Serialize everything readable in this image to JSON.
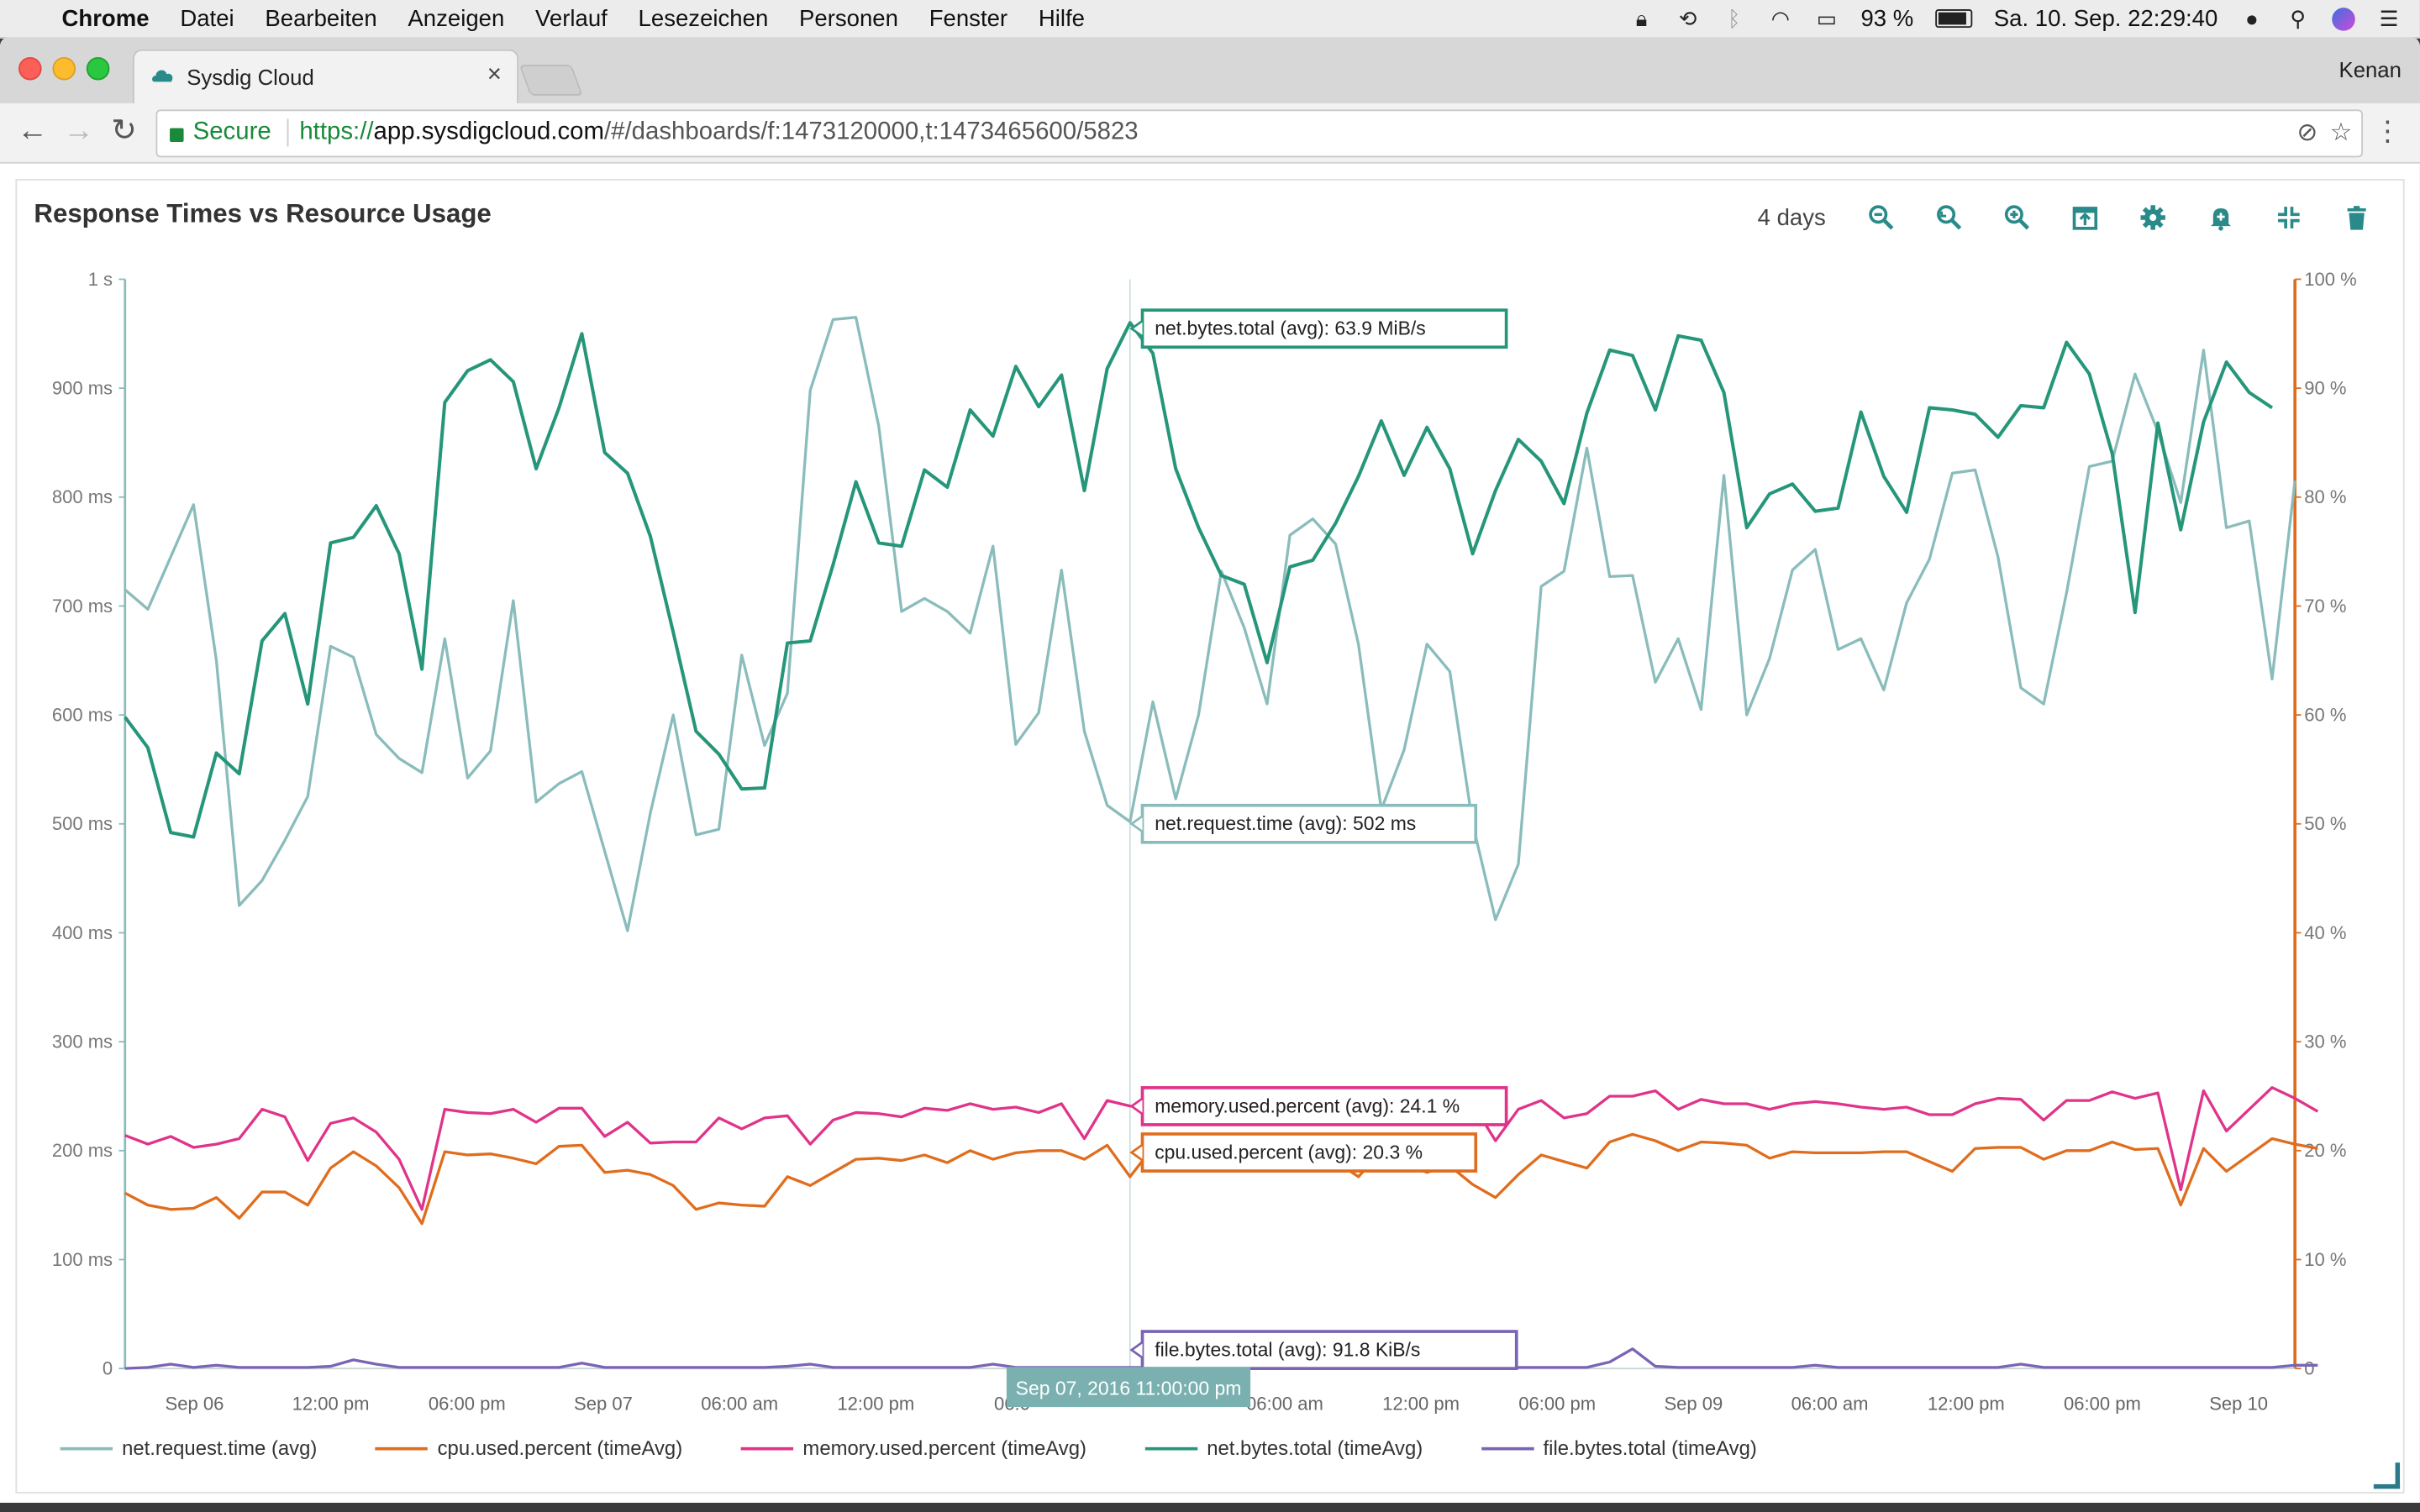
{
  "menubar": {
    "app": "Chrome",
    "items": [
      "Datei",
      "Bearbeiten",
      "Anzeigen",
      "Verlauf",
      "Lesezeichen",
      "Personen",
      "Fenster",
      "Hilfe"
    ],
    "battery": "93 %",
    "datetime": "Sa. 10. Sep.  22:29:40"
  },
  "browser": {
    "tab_title": "Sysdig Cloud",
    "profile": "Kenan",
    "secure_label": "Secure",
    "url_scheme": "https://",
    "url_host": "app.sysdigcloud.com",
    "url_path": "/#/dashboards/f:1473120000,t:1473465600/5823"
  },
  "panel": {
    "title": "Response Times vs Resource Usage",
    "time_range": "4 days",
    "tool_icons": [
      "zoom-out-icon",
      "zoom-reset-icon",
      "zoom-in-icon",
      "open-panel-icon",
      "settings-icon",
      "alert-icon",
      "collapse-icon",
      "delete-icon"
    ],
    "accent": "#2a8a8a"
  },
  "chart_data": {
    "type": "line",
    "x_ticks": [
      "Sep 06",
      "12:00 pm",
      "06:00 pm",
      "Sep 07",
      "06:00 am",
      "12:00 pm",
      "06:0",
      "",
      "06:00 am",
      "12:00 pm",
      "06:00 pm",
      "Sep 09",
      "06:00 am",
      "12:00 pm",
      "06:00 pm",
      "Sep 10"
    ],
    "y_left_ticks": [
      "0",
      "100 ms",
      "200 ms",
      "300 ms",
      "400 ms",
      "500 ms",
      "600 ms",
      "700 ms",
      "800 ms",
      "900 ms",
      "1 s"
    ],
    "y_right_ticks": [
      "0",
      "10 %",
      "20 %",
      "30 %",
      "40 %",
      "50 %",
      "60 %",
      "70 %",
      "80 %",
      "90 %",
      "100 %"
    ],
    "y_left_range": [
      0,
      1000
    ],
    "y_right_range": [
      0,
      100
    ],
    "hover_time": "Sep 07, 2016 11:00:00 pm",
    "series": [
      {
        "name": "net.request.time (avg)",
        "color": "#8bbcbc",
        "axis": "left",
        "tooltip": "net.request.time (avg): 502 ms",
        "values": [
          715,
          697,
          745,
          793,
          650,
          425,
          448,
          485,
          525,
          663,
          653,
          582,
          560,
          547,
          670,
          542,
          567,
          705,
          520,
          537,
          548,
          475,
          402,
          510,
          600,
          490,
          495,
          655,
          572,
          620,
          898,
          963,
          965,
          865,
          695,
          707,
          695,
          675,
          755,
          573,
          602,
          733,
          585,
          517,
          502,
          612,
          523,
          600,
          732,
          680,
          610,
          765,
          780,
          757,
          665,
          513,
          568,
          665,
          640,
          500,
          412,
          463,
          718,
          732,
          845,
          727,
          728,
          630,
          670,
          605,
          820,
          600,
          652,
          733,
          752,
          660,
          670,
          623,
          703,
          743,
          822,
          825,
          745,
          625,
          610,
          712,
          828,
          833,
          913,
          860,
          795,
          935,
          772,
          778,
          633,
          815
        ]
      },
      {
        "name": "cpu.used.percent (timeAvg)",
        "color": "#e06d1e",
        "axis": "right",
        "tooltip": "cpu.used.percent (avg): 20.3 %",
        "values": [
          16.1,
          15.0,
          14.6,
          14.7,
          15.7,
          13.8,
          16.2,
          16.2,
          15.0,
          18.4,
          19.9,
          18.6,
          16.6,
          13.3,
          19.9,
          19.6,
          19.7,
          19.3,
          18.8,
          20.4,
          20.5,
          18.0,
          18.2,
          17.8,
          16.8,
          14.6,
          15.2,
          15.0,
          14.9,
          17.6,
          16.8,
          18.0,
          19.2,
          19.3,
          19.1,
          19.6,
          18.9,
          20.0,
          19.2,
          19.8,
          20.0,
          20.0,
          19.2,
          20.5,
          17.6,
          20.3,
          20.2,
          19.0,
          18.9,
          19.6,
          19.3,
          19.3,
          18.9,
          19.0,
          17.6,
          19.9,
          18.8,
          18.0,
          18.6,
          16.9,
          15.7,
          17.8,
          19.6,
          19.0,
          18.4,
          20.8,
          21.5,
          20.9,
          20.0,
          20.8,
          20.7,
          20.5,
          19.3,
          19.9,
          19.8,
          19.8,
          19.8,
          19.9,
          19.9,
          19.0,
          18.1,
          20.2,
          20.3,
          20.3,
          19.2,
          20.0,
          20.0,
          20.8,
          20.1,
          20.2,
          15.0,
          20.2,
          18.1,
          19.6,
          21.1,
          20.6,
          20.2
        ]
      },
      {
        "name": "memory.used.percent (timeAvg)",
        "color": "#e0338a",
        "axis": "right",
        "tooltip": "memory.used.percent (avg): 24.1 %",
        "values": [
          21.4,
          20.6,
          21.3,
          20.3,
          20.6,
          21.1,
          23.8,
          23.1,
          19.1,
          22.5,
          23.0,
          21.7,
          19.2,
          14.6,
          23.8,
          23.5,
          23.4,
          23.8,
          22.6,
          23.9,
          23.9,
          21.3,
          22.6,
          20.7,
          20.8,
          20.8,
          23.0,
          22.0,
          23.0,
          23.2,
          20.6,
          22.8,
          23.5,
          23.4,
          23.1,
          23.9,
          23.7,
          24.3,
          23.8,
          24.0,
          23.5,
          24.3,
          21.1,
          24.6,
          24.1,
          24.0,
          24.5,
          24.3,
          24.3,
          24.0,
          24.4,
          24.0,
          24.3,
          24.1,
          24.5,
          24.5,
          24.1,
          23.8,
          24.6,
          24.3,
          20.9,
          23.8,
          24.6,
          23.0,
          23.4,
          25.0,
          25.0,
          25.5,
          23.8,
          24.7,
          24.3,
          24.3,
          23.8,
          24.3,
          24.5,
          24.3,
          24.0,
          23.8,
          24.0,
          23.3,
          23.3,
          24.3,
          24.8,
          24.7,
          22.8,
          24.6,
          24.6,
          25.4,
          24.8,
          25.3,
          16.4,
          25.5,
          21.8,
          23.8,
          25.8,
          24.8,
          23.6
        ]
      },
      {
        "name": "net.bytes.total (timeAvg)",
        "color": "#26967a",
        "axis": "right",
        "tooltip": "net.bytes.total (avg): 63.9 MiB/s",
        "values": [
          59.8,
          57.0,
          49.2,
          48.8,
          56.5,
          54.6,
          66.8,
          69.3,
          61.0,
          75.8,
          76.3,
          79.2,
          74.8,
          64.2,
          88.7,
          91.6,
          92.6,
          90.6,
          82.6,
          88.2,
          95.0,
          84.1,
          82.2,
          76.4,
          67.6,
          58.5,
          56.4,
          53.2,
          53.3,
          66.6,
          66.8,
          73.8,
          81.4,
          75.8,
          75.5,
          82.5,
          80.9,
          88.0,
          85.6,
          92.0,
          88.3,
          91.2,
          80.6,
          91.8,
          96.0,
          93.2,
          82.6,
          77.2,
          72.8,
          72.0,
          64.8,
          73.6,
          74.2,
          77.6,
          81.9,
          87.0,
          82.0,
          86.4,
          82.6,
          74.8,
          80.6,
          85.3,
          83.3,
          79.4,
          87.7,
          93.5,
          93.0,
          88.0,
          94.8,
          94.4,
          89.6,
          77.2,
          80.3,
          81.2,
          78.7,
          79.0,
          87.8,
          81.9,
          78.6,
          88.2,
          88.0,
          87.6,
          85.5,
          88.4,
          88.2,
          94.2,
          91.3,
          84.0,
          69.4,
          86.8,
          77.0,
          86.9,
          92.4,
          89.6,
          88.2
        ]
      },
      {
        "name": "file.bytes.total (timeAvg)",
        "color": "#7a64b4",
        "axis": "right",
        "tooltip": "file.bytes.total (avg): 91.8 KiB/s",
        "values": [
          0.0,
          0.1,
          0.4,
          0.1,
          0.3,
          0.1,
          0.1,
          0.1,
          0.1,
          0.2,
          0.8,
          0.4,
          0.1,
          0.1,
          0.1,
          0.1,
          0.1,
          0.1,
          0.1,
          0.1,
          0.5,
          0.1,
          0.1,
          0.1,
          0.1,
          0.1,
          0.1,
          0.1,
          0.1,
          0.2,
          0.4,
          0.1,
          0.1,
          0.1,
          0.1,
          0.1,
          0.1,
          0.1,
          0.4,
          0.1,
          0.1,
          0.1,
          0.1,
          0.1,
          0.1,
          0.1,
          0.1,
          0.1,
          0.1,
          0.1,
          0.1,
          0.1,
          0.1,
          0.1,
          0.1,
          0.1,
          0.1,
          0.1,
          0.1,
          0.1,
          0.1,
          0.1,
          0.1,
          0.1,
          0.1,
          0.6,
          1.8,
          0.2,
          0.1,
          0.1,
          0.1,
          0.1,
          0.1,
          0.1,
          0.3,
          0.1,
          0.1,
          0.1,
          0.1,
          0.1,
          0.1,
          0.1,
          0.1,
          0.4,
          0.1,
          0.1,
          0.1,
          0.1,
          0.1,
          0.1,
          0.1,
          0.1,
          0.1,
          0.1,
          0.1,
          0.3,
          0.3
        ]
      }
    ]
  }
}
